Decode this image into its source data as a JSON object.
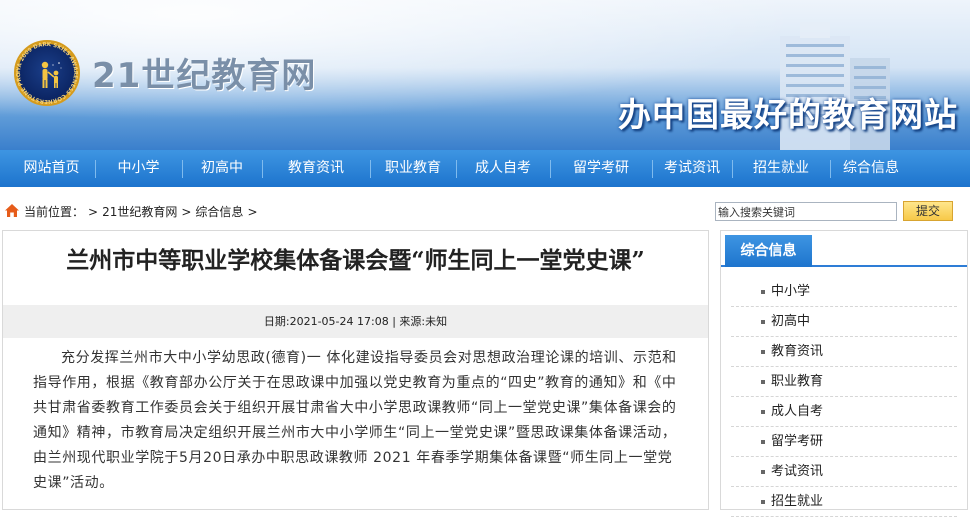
{
  "header": {
    "site_name": "21世纪教育网",
    "slogan": "办中国最好的教育网站",
    "logo_ring_text": "IYA 2009 DARK SKIES AWARENESS CORNERSTONE PROJECT"
  },
  "nav": {
    "items": [
      "网站首页",
      "中小学",
      "初高中",
      "教育资讯",
      "职业教育",
      "成人自考",
      "留学考研",
      "考试资讯",
      "招生就业",
      "综合信息"
    ]
  },
  "breadcrumb": {
    "label": "当前位置：",
    "items": [
      "21世纪教育网",
      "综合信息"
    ],
    "separator": ">"
  },
  "search": {
    "placeholder": "输入搜索关键词",
    "button": "提交"
  },
  "article": {
    "title": "兰州市中等职业学校集体备课会暨“师生同上一堂党史课”",
    "meta": "日期:2021-05-24 17:08 | 来源:未知",
    "body": "充分发挥兰州市大中小学幼思政(德育)一 体化建设指导委员会对思想政治理论课的培训、示范和指导作用，根据《教育部办公厅关于在思政课中加强以党史教育为重点的“四史”教育的通知》和《中共甘肃省委教育工作委员会关于组织开展甘肃省大中小学思政课教师“同上一堂党史课”集体备课会的通知》精神，市教育局决定组织开展兰州市大中小学师生“同上一堂党史课”暨思政课集体备课活动，由兰州现代职业学院于5月20日承办中职思政课教师 2021 年春季学期集体备课暨“师生同上一堂党史课”活动。"
  },
  "sidebar": {
    "title": "综合信息",
    "items": [
      "中小学",
      "初高中",
      "教育资讯",
      "职业教育",
      "成人自考",
      "留学考研",
      "考试资讯",
      "招生就业"
    ]
  },
  "colors": {
    "nav_blue": "#2a84d8",
    "button_yellow": "#f7c948",
    "logo_gold": "#d59b1d"
  }
}
